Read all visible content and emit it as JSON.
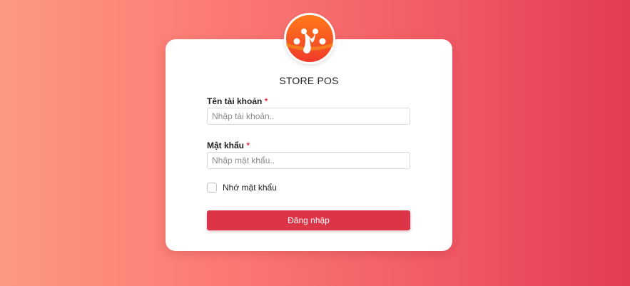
{
  "app": {
    "title": "STORE POS",
    "logo_icon": "store-pos-logo",
    "brand_colors": {
      "logo_gradient_top": "#ff6f1a",
      "logo_gradient_bottom": "#f03a2a",
      "primary_button": "#dd3548",
      "required_star": "#e23b4e"
    }
  },
  "login_form": {
    "username": {
      "label": "Tên tài khoản",
      "required_mark": "*",
      "value": "",
      "placeholder": "Nhập tài khoản.."
    },
    "password": {
      "label": "Mật khẩu",
      "required_mark": "*",
      "value": "",
      "placeholder": "Nhập mật khẩu.."
    },
    "remember": {
      "label": "Nhớ mật khẩu",
      "checked": false
    },
    "submit_label": "Đăng nhập"
  }
}
